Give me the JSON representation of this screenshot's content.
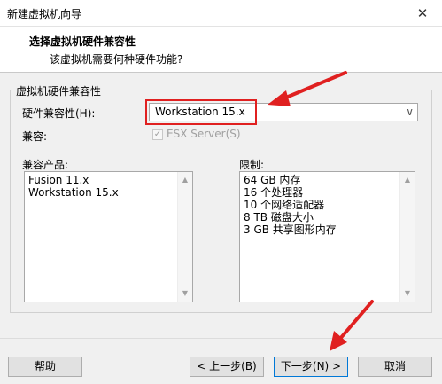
{
  "window": {
    "title": "新建虚拟机向导",
    "close_glyph": "✕"
  },
  "header": {
    "title": "选择虚拟机硬件兼容性",
    "subtitle": "该虚拟机需要何种硬件功能?"
  },
  "group": {
    "label": "虚拟机硬件兼容性"
  },
  "hardware_compat": {
    "label": "硬件兼容性(H):",
    "value": "Workstation 15.x",
    "arrow": "∨"
  },
  "compat": {
    "label": "兼容:",
    "checkbox_label": "ESX Server(S)",
    "checked": true,
    "check_glyph": "✓"
  },
  "compatible_products": {
    "label": "兼容产品:",
    "items": [
      "Fusion 11.x",
      "Workstation 15.x"
    ]
  },
  "limits": {
    "label": "限制:",
    "items": [
      "64 GB 内存",
      "16 个处理器",
      "10 个网络适配器",
      "8 TB 磁盘大小",
      "3 GB 共享图形内存"
    ]
  },
  "scroll": {
    "up": "▲",
    "down": "▼"
  },
  "buttons": {
    "help": "帮助",
    "back": "< 上一步(B)",
    "next": "下一步(N) >",
    "cancel": "取消"
  },
  "colors": {
    "annotation_red": "#e02020",
    "default_button_border": "#0078d7"
  }
}
